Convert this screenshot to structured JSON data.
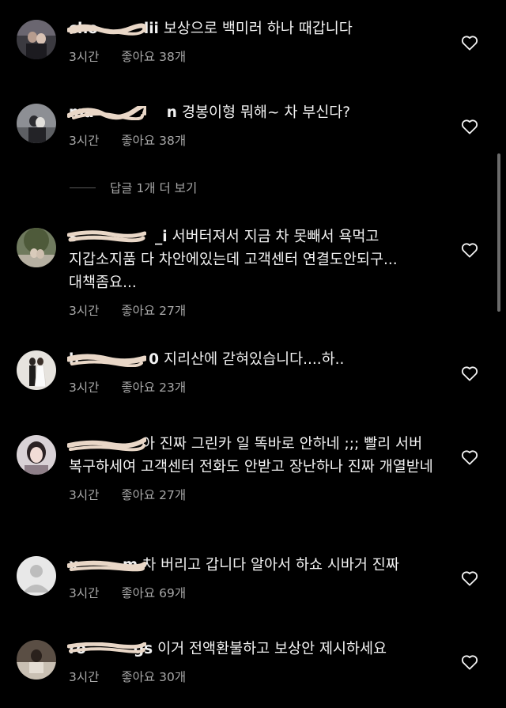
{
  "comments": [
    {
      "username": "cho",
      "username_tail": "lii",
      "text": "보상으로 백미러 하나 때갑니다",
      "time": "3시간",
      "likes": "좋아요 38개",
      "avatar": "photo-couple-dark"
    },
    {
      "username": "ma",
      "username_tail": "n",
      "text": "경봉이형 뭐해~ 차 부신다?",
      "time": "3시간",
      "likes": "좋아요 38개",
      "avatar": "photo-couple-city"
    },
    {
      "username": "s",
      "username_tail": "_i",
      "text": "서버터져서 지금 차 못빼서 욕먹고 지갑소지품 다 차안에있는데 고객센터 연결도안되구... 대책좀요...",
      "time": "3시간",
      "likes": "좋아요 27개",
      "avatar": "photo-outdoor-tree"
    },
    {
      "username": "h",
      "username_tail": "0",
      "text": "지리산에 갇혀있습니다....하..",
      "time": "3시간",
      "likes": "좋아요 23개",
      "avatar": "photo-wedding"
    },
    {
      "username": "",
      "username_tail": "",
      "text": "아 진짜 그린카 일 똑바로 안하네 ;;; 빨리 서버 복구하세여 고객센터 전화도 안받고 장난하나 진짜 개열받네",
      "time": "3시간",
      "likes": "좋아요 27개",
      "avatar": "photo-selfie-girl"
    },
    {
      "username": "x",
      "username_tail": "m",
      "text": "차 버리고 갑니다 알아서 하쇼 시바거 진짜",
      "time": "3시간",
      "likes": "좋아요 69개",
      "avatar": "default-avatar"
    },
    {
      "username": "ro",
      "username_tail": "gs",
      "text": "이거 전액환불하고 보상안 제시하세요",
      "time": "3시간",
      "likes": "좋아요 30개",
      "avatar": "photo-man-desk"
    }
  ],
  "replies_toggle": {
    "label": "답글 1개 더 보기"
  },
  "colors": {
    "background": "#000000",
    "text": "#f2f2f2",
    "secondary": "#a8a8a8",
    "scribble": "#e9d7c7"
  },
  "icons": {
    "like": "heart-outline-icon"
  }
}
